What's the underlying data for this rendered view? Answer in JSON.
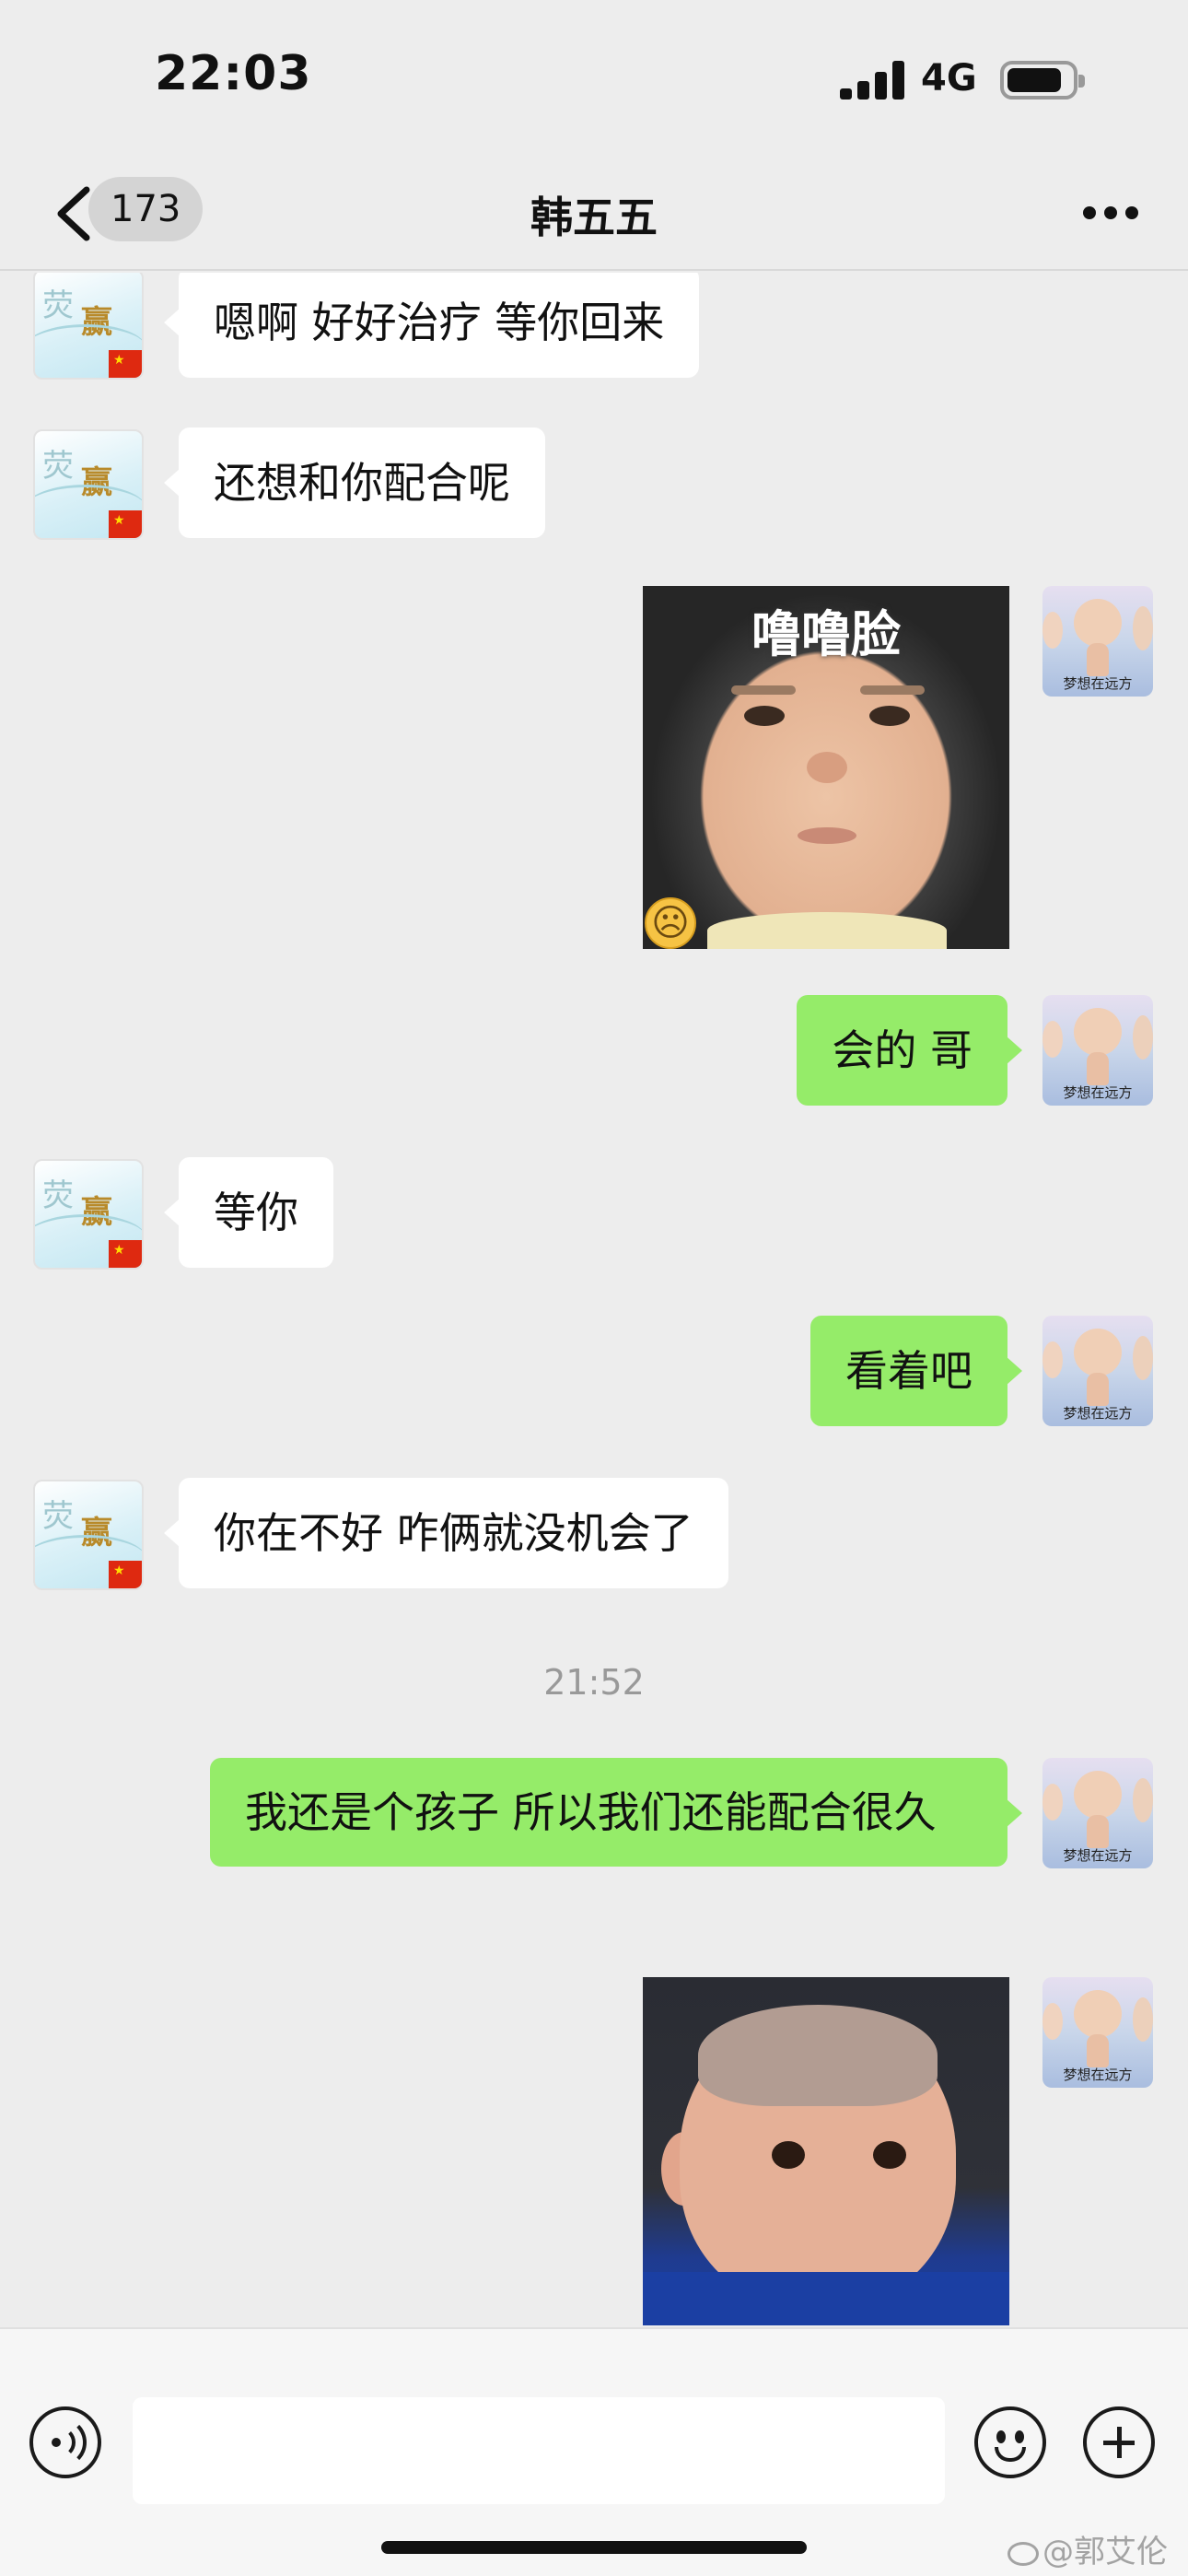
{
  "status_bar": {
    "time": "22:03",
    "network": "4G"
  },
  "nav": {
    "back_count": "173",
    "title": "韩五五"
  },
  "messages": [
    {
      "side": "left",
      "type": "text",
      "text": "嗯啊 好好治疗 等你回来"
    },
    {
      "side": "left",
      "type": "text",
      "text": "还想和你配合呢"
    },
    {
      "side": "right",
      "type": "sticker",
      "caption": "噜噜脸"
    },
    {
      "side": "right",
      "type": "text",
      "text": "会的 哥"
    },
    {
      "side": "left",
      "type": "text",
      "text": "等你"
    },
    {
      "side": "right",
      "type": "text",
      "text": "看着吧"
    },
    {
      "side": "left",
      "type": "text",
      "text": "你在不好 咋俩就没机会了"
    },
    {
      "type": "time",
      "text": "21:52"
    },
    {
      "side": "right",
      "type": "text",
      "text": "我还是个孩子 所以我们还能配合很久"
    },
    {
      "side": "right",
      "type": "sticker",
      "caption": ""
    }
  ],
  "avatars": {
    "left_text": "荧 赢",
    "right_caption": "梦想在远方"
  },
  "input": {
    "value": "",
    "placeholder": ""
  },
  "watermark": "@郭艾伦",
  "colors": {
    "background": "#ededed",
    "sent_bubble": "#95ec69",
    "received_bubble": "#ffffff",
    "time_text": "#999999"
  },
  "icons": {
    "back": "chevron-left-icon",
    "more": "more-dots-icon",
    "voice": "voice-icon",
    "emoji": "emoji-icon",
    "plus": "plus-icon"
  }
}
